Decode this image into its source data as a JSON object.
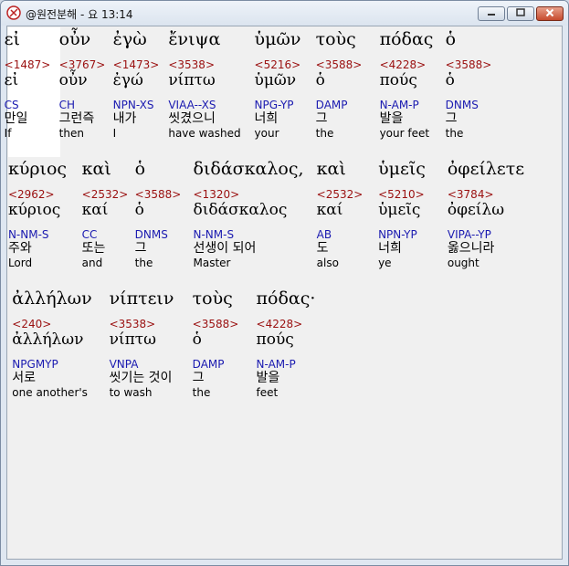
{
  "window": {
    "title": "@원전분해 - 요 13:14"
  },
  "rows": [
    [
      {
        "greek": "εἰ",
        "num": "<1487>",
        "lemma": "εἰ",
        "pos": "CS",
        "kor": "만일",
        "eng": "If"
      },
      {
        "greek": "οὖν",
        "num": "<3767>",
        "lemma": "οὖν",
        "pos": "CH",
        "kor": "그런즉",
        "eng": "then"
      },
      {
        "greek": "ἐγὼ",
        "num": "<1473>",
        "lemma": "ἐγώ",
        "pos": "NPN-XS",
        "kor": "내가",
        "eng": "I"
      },
      {
        "greek": "ἔνιψα",
        "num": "<3538>",
        "lemma": "νίπτω",
        "pos": "VIAA--XS",
        "kor": "씻겼으니",
        "eng": "have washed"
      },
      {
        "greek": "ὑμῶν",
        "num": "<5216>",
        "lemma": "ὑμῶν",
        "pos": "NPG-YP",
        "kor": "너희",
        "eng": "your"
      },
      {
        "greek": "τοὺς",
        "num": "<3588>",
        "lemma": "ὁ",
        "pos": "DAMP",
        "kor": "그",
        "eng": "the"
      },
      {
        "greek": "πόδας",
        "num": "<4228>",
        "lemma": "πούς",
        "pos": "N-AM-P",
        "kor": "발을",
        "eng": "your feet"
      },
      {
        "greek": "ὁ",
        "num": "<3588>",
        "lemma": "ὁ",
        "pos": "DNMS",
        "kor": "그",
        "eng": "the"
      }
    ],
    [
      {
        "greek": "κύριος",
        "num": "<2962>",
        "lemma": "κύριος",
        "pos": "N-NM-S",
        "kor": "주와",
        "eng": "Lord"
      },
      {
        "greek": "καὶ",
        "num": "<2532>",
        "lemma": "καί",
        "pos": "CC",
        "kor": "또는",
        "eng": "and"
      },
      {
        "greek": "ὁ",
        "num": "<3588>",
        "lemma": "ὁ",
        "pos": "DNMS",
        "kor": "그",
        "eng": "the"
      },
      {
        "greek": "διδάσκαλος,",
        "num": "<1320>",
        "lemma": "διδάσκαλος",
        "pos": "N-NM-S",
        "kor": "선생이 되어",
        "eng": "Master"
      },
      {
        "greek": "καὶ",
        "num": "<2532>",
        "lemma": "καί",
        "pos": "AB",
        "kor": "도",
        "eng": "also"
      },
      {
        "greek": "ὑμεῖς",
        "num": "<5210>",
        "lemma": "ὑμεῖς",
        "pos": "NPN-YP",
        "kor": "너희",
        "eng": "ye"
      },
      {
        "greek": "ὀφείλετε",
        "num": "<3784>",
        "lemma": "ὀφείλω",
        "pos": "VIPA--YP",
        "kor": "옳으니라",
        "eng": "ought"
      }
    ],
    [
      {
        "greek": "ἀλλήλων",
        "num": "<240>",
        "lemma": "ἀλλήλων",
        "pos": "NPGMYP",
        "kor": "서로",
        "eng": "one another's"
      },
      {
        "greek": "νίπτειν",
        "num": "<3538>",
        "lemma": "νίπτω",
        "pos": "VNPA",
        "kor": "씻기는 것이",
        "eng": "to wash"
      },
      {
        "greek": "τοὺς",
        "num": "<3588>",
        "lemma": "ὁ",
        "pos": "DAMP",
        "kor": "그",
        "eng": "the"
      },
      {
        "greek": "πόδας·",
        "num": "<4228>",
        "lemma": "πούς",
        "pos": "N-AM-P",
        "kor": "발을",
        "eng": "feet"
      }
    ]
  ]
}
